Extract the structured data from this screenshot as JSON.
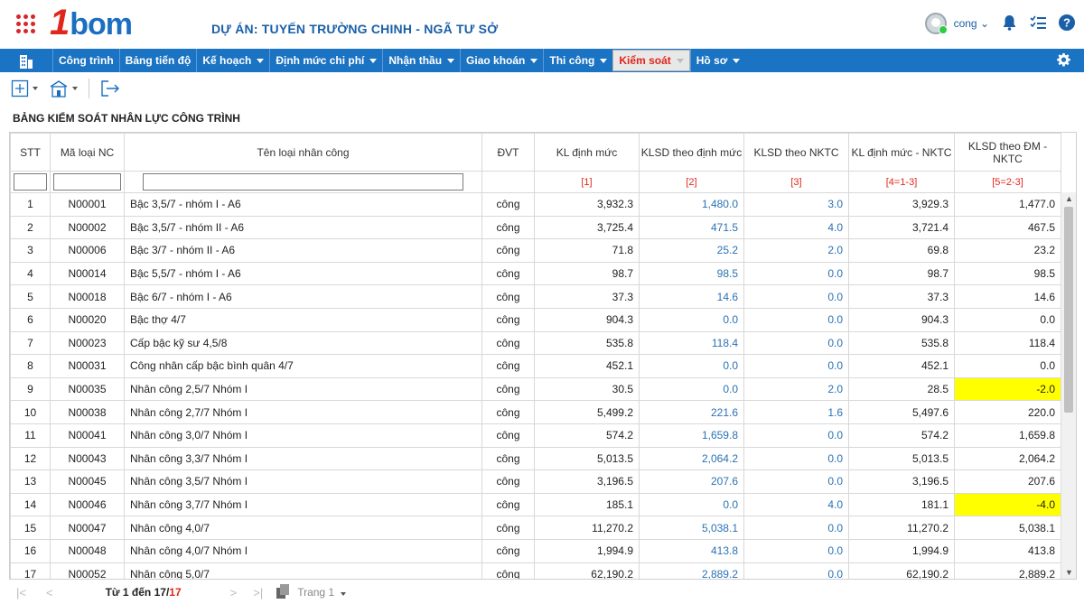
{
  "header": {
    "logo_main": "1bom",
    "project_title": "DỰ ÁN: TUYẾN TRƯỜNG CHINH - NGÃ TƯ SỞ",
    "username": "cong",
    "colors": {
      "brand_blue": "#1b73c3",
      "brand_red": "#e1251b",
      "highlight": "#ffff00"
    }
  },
  "nav": {
    "items": [
      {
        "label": "Công trình",
        "has_dropdown": false
      },
      {
        "label": "Bảng tiến độ",
        "has_dropdown": false
      },
      {
        "label": "Kế hoạch",
        "has_dropdown": true
      },
      {
        "label": "Định mức chi phí",
        "has_dropdown": true
      },
      {
        "label": "Nhận thầu",
        "has_dropdown": true
      },
      {
        "label": "Giao khoán",
        "has_dropdown": true
      },
      {
        "label": "Thi công",
        "has_dropdown": true
      },
      {
        "label": "Kiểm soát",
        "has_dropdown": true,
        "active": true
      },
      {
        "label": "Hồ sơ",
        "has_dropdown": true
      }
    ]
  },
  "page": {
    "title": "BẢNG KIỂM SOÁT NHÂN LỰC CÔNG TRÌNH"
  },
  "table": {
    "columns": [
      "STT",
      "Mã loại NC",
      "Tên loại nhân công",
      "ĐVT",
      "KL định mức",
      "KLSD theo định mức",
      "KLSD theo NKTC",
      "KL định mức - NKTC",
      "KLSD theo ĐM - NKTC"
    ],
    "formula_labels": [
      "",
      "",
      "",
      "",
      "[1]",
      "[2]",
      "[3]",
      "[4=1-3]",
      "[5=2-3]"
    ],
    "rows": [
      {
        "stt": "1",
        "code": "N00001",
        "name": "Bậc 3,5/7 - nhóm I - A6",
        "unit": "công",
        "kl_dm": "3,932.3",
        "klsd_dm": "1,480.0",
        "klsd_nktc": "3.0",
        "diff1": "3,929.3",
        "diff2": "1,477.0",
        "neg": false
      },
      {
        "stt": "2",
        "code": "N00002",
        "name": "Bậc 3,5/7 - nhóm II - A6",
        "unit": "công",
        "kl_dm": "3,725.4",
        "klsd_dm": "471.5",
        "klsd_nktc": "4.0",
        "diff1": "3,721.4",
        "diff2": "467.5",
        "neg": false
      },
      {
        "stt": "3",
        "code": "N00006",
        "name": "Bậc 3/7 - nhóm II - A6",
        "unit": "công",
        "kl_dm": "71.8",
        "klsd_dm": "25.2",
        "klsd_nktc": "2.0",
        "diff1": "69.8",
        "diff2": "23.2",
        "neg": false
      },
      {
        "stt": "4",
        "code": "N00014",
        "name": "Bậc 5,5/7 - nhóm I - A6",
        "unit": "công",
        "kl_dm": "98.7",
        "klsd_dm": "98.5",
        "klsd_nktc": "0.0",
        "diff1": "98.7",
        "diff2": "98.5",
        "neg": false
      },
      {
        "stt": "5",
        "code": "N00018",
        "name": "Bậc 6/7 - nhóm I - A6",
        "unit": "công",
        "kl_dm": "37.3",
        "klsd_dm": "14.6",
        "klsd_nktc": "0.0",
        "diff1": "37.3",
        "diff2": "14.6",
        "neg": false
      },
      {
        "stt": "6",
        "code": "N00020",
        "name": "Bậc thợ 4/7",
        "unit": "công",
        "kl_dm": "904.3",
        "klsd_dm": "0.0",
        "klsd_nktc": "0.0",
        "diff1": "904.3",
        "diff2": "0.0",
        "neg": false
      },
      {
        "stt": "7",
        "code": "N00023",
        "name": "Cấp bậc kỹ sư 4,5/8",
        "unit": "công",
        "kl_dm": "535.8",
        "klsd_dm": "118.4",
        "klsd_nktc": "0.0",
        "diff1": "535.8",
        "diff2": "118.4",
        "neg": false
      },
      {
        "stt": "8",
        "code": "N00031",
        "name": "Công nhân cấp bậc bình quân 4/7",
        "unit": "công",
        "kl_dm": "452.1",
        "klsd_dm": "0.0",
        "klsd_nktc": "0.0",
        "diff1": "452.1",
        "diff2": "0.0",
        "neg": false
      },
      {
        "stt": "9",
        "code": "N00035",
        "name": "Nhân công 2,5/7 Nhóm I",
        "unit": "công",
        "kl_dm": "30.5",
        "klsd_dm": "0.0",
        "klsd_nktc": "2.0",
        "diff1": "28.5",
        "diff2": "-2.0",
        "neg": true
      },
      {
        "stt": "10",
        "code": "N00038",
        "name": "Nhân công 2,7/7 Nhóm I",
        "unit": "công",
        "kl_dm": "5,499.2",
        "klsd_dm": "221.6",
        "klsd_nktc": "1.6",
        "diff1": "5,497.6",
        "diff2": "220.0",
        "neg": false
      },
      {
        "stt": "11",
        "code": "N00041",
        "name": "Nhân công 3,0/7 Nhóm I",
        "unit": "công",
        "kl_dm": "574.2",
        "klsd_dm": "1,659.8",
        "klsd_nktc": "0.0",
        "diff1": "574.2",
        "diff2": "1,659.8",
        "neg": false
      },
      {
        "stt": "12",
        "code": "N00043",
        "name": "Nhân công 3,3/7 Nhóm I",
        "unit": "công",
        "kl_dm": "5,013.5",
        "klsd_dm": "2,064.2",
        "klsd_nktc": "0.0",
        "diff1": "5,013.5",
        "diff2": "2,064.2",
        "neg": false
      },
      {
        "stt": "13",
        "code": "N00045",
        "name": "Nhân công 3,5/7 Nhóm I",
        "unit": "công",
        "kl_dm": "3,196.5",
        "klsd_dm": "207.6",
        "klsd_nktc": "0.0",
        "diff1": "3,196.5",
        "diff2": "207.6",
        "neg": false
      },
      {
        "stt": "14",
        "code": "N00046",
        "name": "Nhân công 3,7/7 Nhóm I",
        "unit": "công",
        "kl_dm": "185.1",
        "klsd_dm": "0.0",
        "klsd_nktc": "4.0",
        "diff1": "181.1",
        "diff2": "-4.0",
        "neg": true
      },
      {
        "stt": "15",
        "code": "N00047",
        "name": "Nhân công 4,0/7",
        "unit": "công",
        "kl_dm": "11,270.2",
        "klsd_dm": "5,038.1",
        "klsd_nktc": "0.0",
        "diff1": "11,270.2",
        "diff2": "5,038.1",
        "neg": false
      },
      {
        "stt": "16",
        "code": "N00048",
        "name": "Nhân công 4,0/7 Nhóm I",
        "unit": "công",
        "kl_dm": "1,994.9",
        "klsd_dm": "413.8",
        "klsd_nktc": "0.0",
        "diff1": "1,994.9",
        "diff2": "413.8",
        "neg": false
      },
      {
        "stt": "17",
        "code": "N00052",
        "name": "Nhân công 5,0/7",
        "unit": "công",
        "kl_dm": "62,190.2",
        "klsd_dm": "2,889.2",
        "klsd_nktc": "0.0",
        "diff1": "62,190.2",
        "diff2": "2,889.2",
        "neg": false
      }
    ]
  },
  "pager": {
    "range_prefix": "Từ 1 đến 17/",
    "total": "17",
    "page_label": "Trang 1"
  }
}
